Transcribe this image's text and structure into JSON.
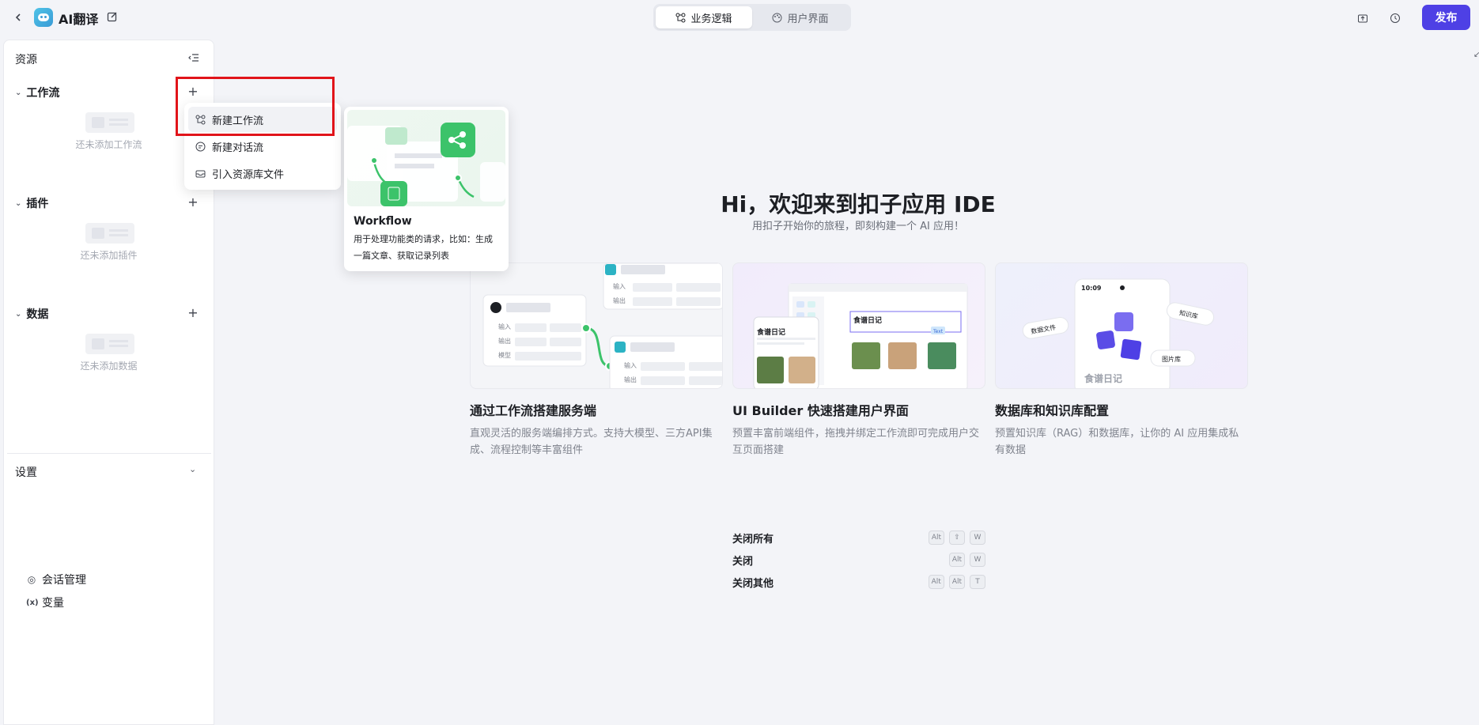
{
  "header": {
    "app_name": "AI翻译",
    "tabs": [
      {
        "label": "业务逻辑",
        "active": true
      },
      {
        "label": "用户界面",
        "active": false
      }
    ],
    "publish_label": "发布"
  },
  "sidebar": {
    "title": "资源",
    "sections": [
      {
        "label": "工作流",
        "empty_text": "还未添加工作流"
      },
      {
        "label": "插件",
        "empty_text": "还未添加插件"
      },
      {
        "label": "数据",
        "empty_text": "还未添加数据"
      }
    ],
    "settings": {
      "title": "设置",
      "items": [
        {
          "label": "会话管理",
          "icon": "chat-settings-icon"
        },
        {
          "label": "变量",
          "icon": "variable-icon"
        }
      ]
    }
  },
  "dropdown": {
    "items": [
      {
        "label": "新建工作流",
        "icon": "workflow-icon"
      },
      {
        "label": "新建对话流",
        "icon": "chat-flow-icon"
      },
      {
        "label": "引入资源库文件",
        "icon": "import-icon"
      }
    ]
  },
  "workflow_popover": {
    "title": "Workflow",
    "desc": "用于处理功能类的请求，比如：生成一篇文章、获取记录列表"
  },
  "welcome": {
    "title": "Hi，欢迎来到扣子应用 IDE",
    "subtitle": "用扣子开始你的旅程，即刻构建一个 AI 应用！",
    "cards": [
      {
        "title": "通过工作流搭建服务端",
        "desc": "直观灵活的服务端编排方式。支持大模型、三方API集成、流程控制等丰富组件",
        "img_labels": [
          "输入",
          "输出",
          "模型",
          "输入",
          "输出",
          "输入",
          "输出"
        ]
      },
      {
        "title": "UI Builder 快速搭建用户界面",
        "desc": "预置丰富前端组件，拖拽并绑定工作流即可完成用户交互页面搭建",
        "img_labels": [
          "食谱日记",
          "食谱日记",
          "Text"
        ]
      },
      {
        "title": "数据库和知识库配置",
        "desc": "预置知识库（RAG）和数据库，让你的 AI 应用集成私有数据",
        "img_labels": [
          "10:09",
          "数据文件",
          "知识库",
          "图片库",
          "食谱日记"
        ]
      }
    ]
  },
  "shortcuts": [
    {
      "label": "关闭所有",
      "keys": [
        "Alt",
        "⇧",
        "W"
      ]
    },
    {
      "label": "关闭",
      "keys": [
        "Alt",
        "W"
      ]
    },
    {
      "label": "关闭其他",
      "keys": [
        "Alt",
        "Alt",
        "T"
      ]
    }
  ]
}
